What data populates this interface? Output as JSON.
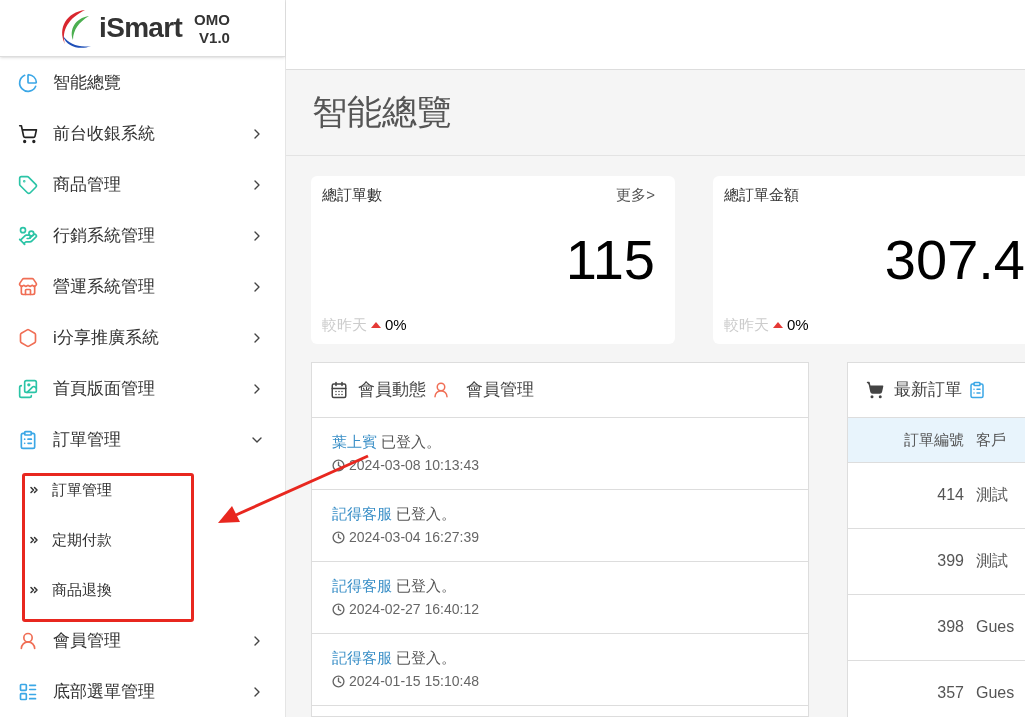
{
  "logo": {
    "name": "iSmart",
    "edition": "OMO",
    "version": "V1.0"
  },
  "sidebar": {
    "items": [
      {
        "label": "智能總覽",
        "kind": "link"
      },
      {
        "label": "前台收銀系統",
        "kind": "group",
        "expanded": false
      },
      {
        "label": "商品管理",
        "kind": "group",
        "expanded": false
      },
      {
        "label": "行銷系統管理",
        "kind": "group",
        "expanded": false
      },
      {
        "label": "營運系統管理",
        "kind": "group",
        "expanded": false
      },
      {
        "label": "i分享推廣系統",
        "kind": "group",
        "expanded": false
      },
      {
        "label": "首頁版面管理",
        "kind": "group",
        "expanded": false
      },
      {
        "label": "訂單管理",
        "kind": "group",
        "expanded": true,
        "children": [
          {
            "label": "訂單管理"
          },
          {
            "label": "定期付款"
          },
          {
            "label": "商品退換"
          }
        ]
      },
      {
        "label": "會員管理",
        "kind": "group",
        "expanded": false
      },
      {
        "label": "底部選單管理",
        "kind": "group",
        "expanded": false
      }
    ]
  },
  "page_title": "智能總覽",
  "stat_cards": [
    {
      "title": "總訂單數",
      "more": "更多>",
      "value": "115",
      "compare_label": "較昨天",
      "rising": true,
      "change": "0%"
    },
    {
      "title": "總訂單金額",
      "value": "307.4",
      "compare_label": "較昨天",
      "rising": true,
      "change": "0%"
    }
  ],
  "member_panel": {
    "title": "會員動態",
    "link": "會員管理",
    "entries": [
      {
        "name": "葉上賓",
        "action": "已登入。",
        "time": "2024-03-08 10:13:43"
      },
      {
        "name": "記得客服",
        "action": "已登入。",
        "time": "2024-03-04 16:27:39"
      },
      {
        "name": "記得客服",
        "action": "已登入。",
        "time": "2024-02-27 16:40:12"
      },
      {
        "name": "記得客服",
        "action": "已登入。",
        "time": "2024-01-15 15:10:48"
      }
    ]
  },
  "orders_panel": {
    "title": "最新訂單",
    "table": {
      "columns": [
        "訂單編號",
        "客戶"
      ],
      "rows": [
        [
          "414",
          "測試"
        ],
        [
          "399",
          "測試"
        ],
        [
          "398",
          "Gues"
        ],
        [
          "357",
          "Gues"
        ]
      ]
    }
  }
}
